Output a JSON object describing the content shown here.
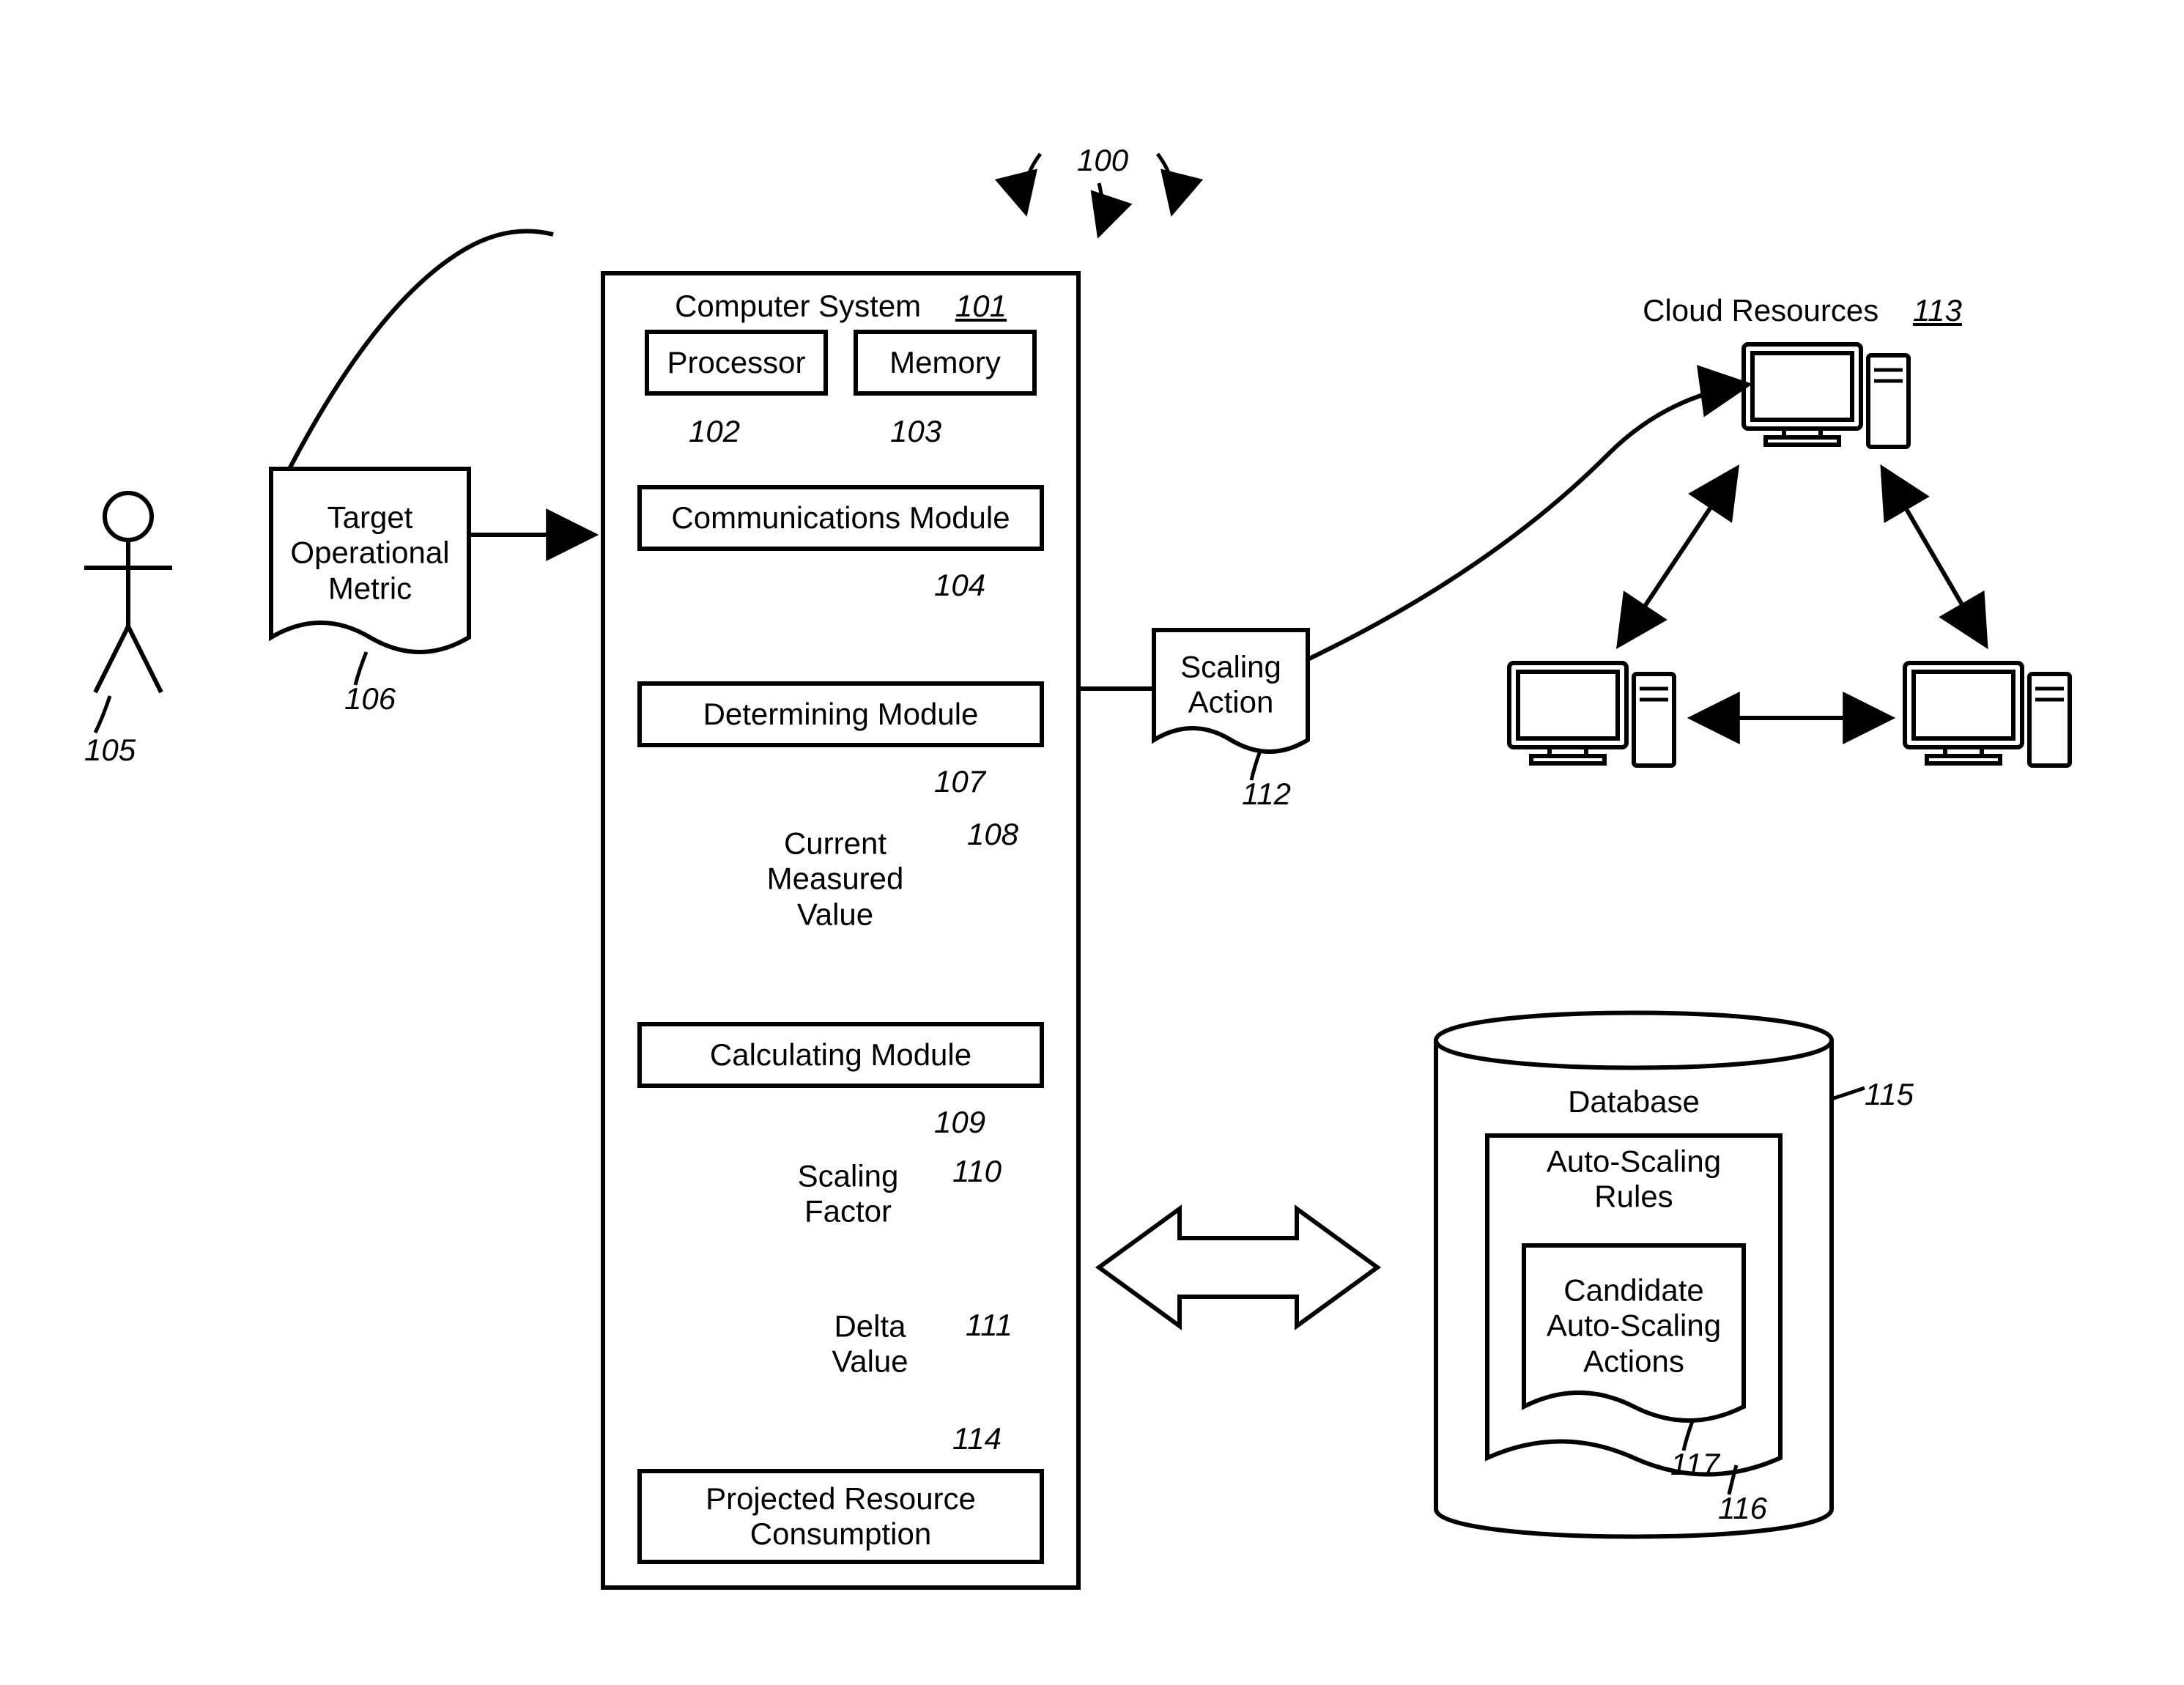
{
  "figure_ref": "100",
  "user": {
    "ref": "105"
  },
  "target_metric": {
    "label": "Target\nOperational\nMetric",
    "ref": "106"
  },
  "computer_system": {
    "title": "Computer System",
    "ref": "101",
    "processor": {
      "label": "Processor",
      "ref": "102"
    },
    "memory": {
      "label": "Memory",
      "ref": "103"
    },
    "comm": {
      "label": "Communications Module",
      "ref": "104"
    },
    "determining": {
      "label": "Determining Module",
      "ref": "107"
    },
    "current_measured": {
      "label": "Current\nMeasured\nValue",
      "ref": "108"
    },
    "calculating": {
      "label": "Calculating Module",
      "ref": "109"
    },
    "scaling_factor": {
      "label": "Scaling\nFactor",
      "ref": "110"
    },
    "delta_value": {
      "label": "Delta\nValue",
      "ref": "111"
    },
    "projected": {
      "label": "Projected Resource\nConsumption",
      "ref": "114"
    }
  },
  "scaling_action": {
    "label": "Scaling\nAction",
    "ref": "112"
  },
  "cloud_resources": {
    "title": "Cloud Resources",
    "ref": "113"
  },
  "database": {
    "title": "Database",
    "ref": "115",
    "auto_scaling_rules": {
      "label": "Auto-Scaling\nRules",
      "ref": "116"
    },
    "candidate_actions": {
      "label": "Candidate\nAuto-Scaling\nActions",
      "ref": "117"
    }
  }
}
